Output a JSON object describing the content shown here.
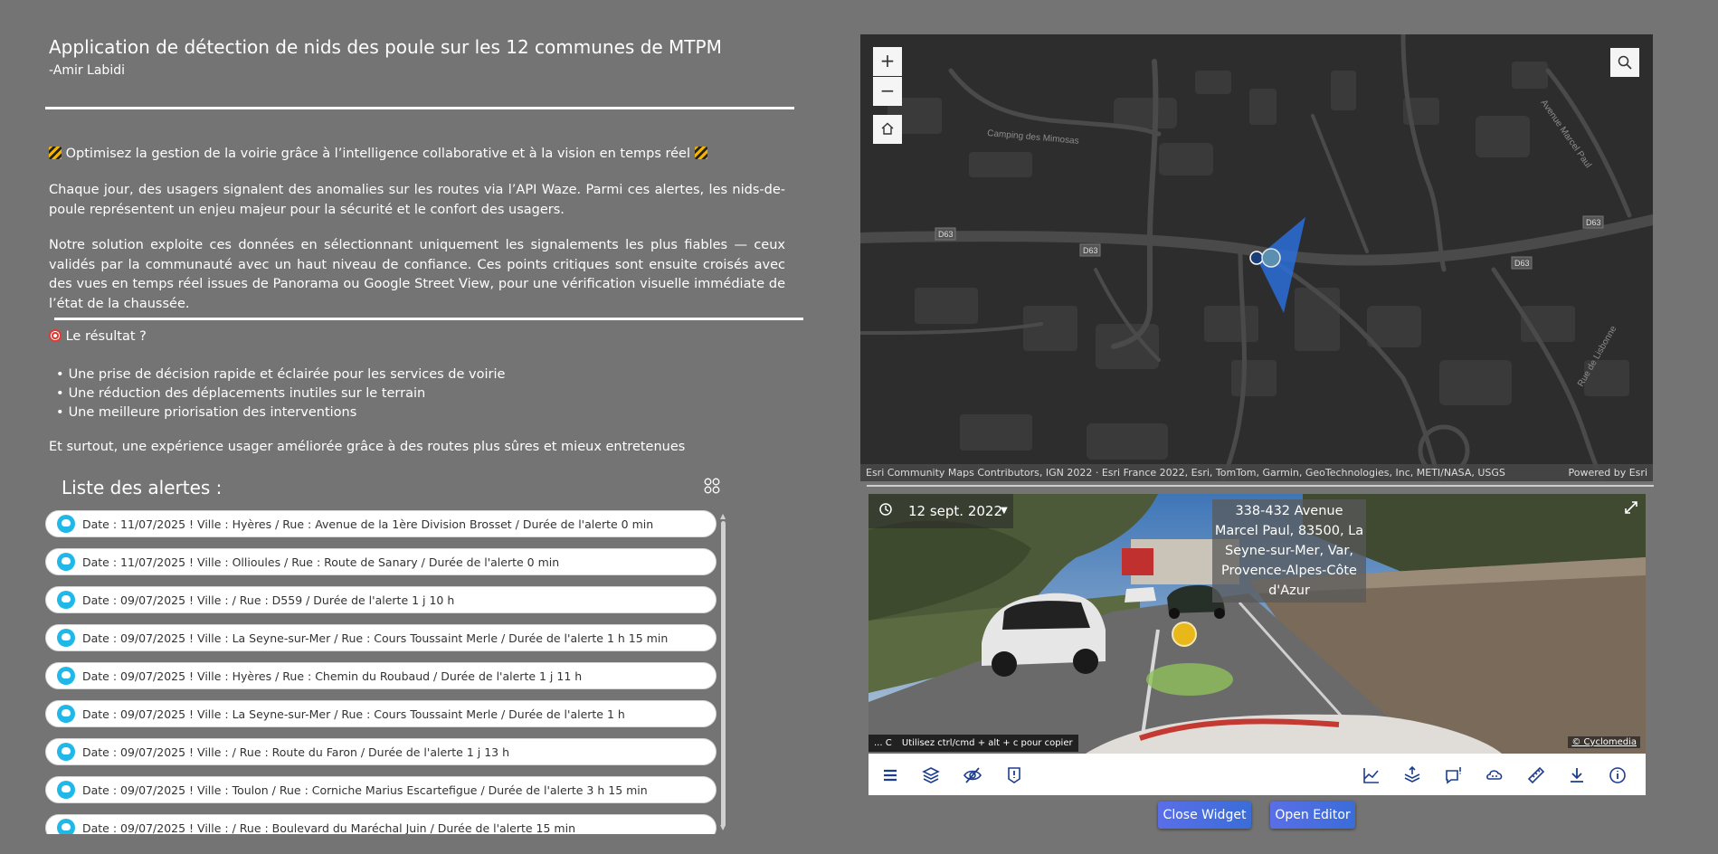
{
  "header": {
    "title": "Application de détection de nids des poule sur les 12 communes de MTPM",
    "author": "-Amir Labidi"
  },
  "intro": {
    "tagline": "Optimisez la gestion de la voirie grâce à l’intelligence collaborative et à la vision en temps réel",
    "paragraph1": "Chaque jour, des usagers signalent des anomalies sur les routes via l’API Waze. Parmi ces alertes, les nids-de-poule représentent un enjeu majeur pour la sécurité et le confort des usagers.",
    "paragraph2": "Notre solution exploite ces données en sélectionnant uniquement les signalements les plus fiables — ceux validés par la communauté avec un haut niveau de confiance. Ces points critiques sont ensuite croisés avec des vues en temps réel issues de Panorama ou Google Street View, pour une vérification visuelle immédiate de l’état de la chaussée."
  },
  "result": {
    "heading": "Le résultat ?",
    "bullets": [
      "Une prise de décision rapide et éclairée pour les services de voirie",
      "Une réduction des déplacements inutiles sur le terrain",
      "Une meilleure priorisation des interventions"
    ],
    "closing": "Et surtout, une expérience usager améliorée grâce à des routes plus sûres et mieux entretenues"
  },
  "alerts": {
    "title": "Liste des alertes :",
    "items": [
      "Date : 11/07/2025 !  Ville :  Hyères /   Rue :  Avenue de la 1ère Division Brosset  / Durée de l'alerte  0 min",
      "Date : 11/07/2025 !  Ville :  Ollioules /   Rue :  Route de Sanary  / Durée de l'alerte  0 min",
      "Date : 09/07/2025 !  Ville :   /   Rue :  D559  / Durée de l'alerte  1 j 10 h",
      "Date : 09/07/2025 !  Ville :  La Seyne-sur-Mer /   Rue :  Cours Toussaint Merle  / Durée de l'alerte  1 h 15 min",
      "Date : 09/07/2025 !  Ville :  Hyères /   Rue :  Chemin du Roubaud  / Durée de l'alerte  1 j 11 h",
      "Date : 09/07/2025 !  Ville :  La Seyne-sur-Mer /   Rue :  Cours Toussaint Merle  / Durée de l'alerte  1 h",
      "Date : 09/07/2025 !  Ville :   /   Rue :  Route du Faron  / Durée de l'alerte  1 j 13 h",
      "Date : 09/07/2025 !  Ville :  Toulon /   Rue :  Corniche Marius Escartefigue  / Durée de l'alerte  3 h 15 min",
      "Date : 09/07/2025 !  Ville :   /   Rue :  Boulevard du Maréchal Juin  / Durée de l'alerte  15 min"
    ]
  },
  "map": {
    "zoom_in": "+",
    "zoom_out": "−",
    "labels": {
      "camping": "Camping des Mimosas",
      "avenue": "Avenue Marcel Paul",
      "rue": "Rue de Lisbonne",
      "d63": "D63"
    },
    "attribution": "Esri Community Maps Contributors, IGN 2022 · Esri France 2022, Esri, TomTom, Garmin, GeoTechnologies, Inc, METI/NASA, USGS",
    "powered_by": "Powered by Esri"
  },
  "streetview": {
    "date": "12 sept. 2022",
    "address": "338-432 Avenue Marcel Paul, 83500, La Seyne-sur-Mer, Var, Provence-Alpes-Côte d'Azur",
    "copy_hint": "Utilisez ctrl/cmd + alt + c pour copier",
    "copyright": "© Cyclomedia",
    "left_stub": "... C"
  },
  "buttons": {
    "close_widget": "Close Widget",
    "open_editor": "Open Editor"
  }
}
